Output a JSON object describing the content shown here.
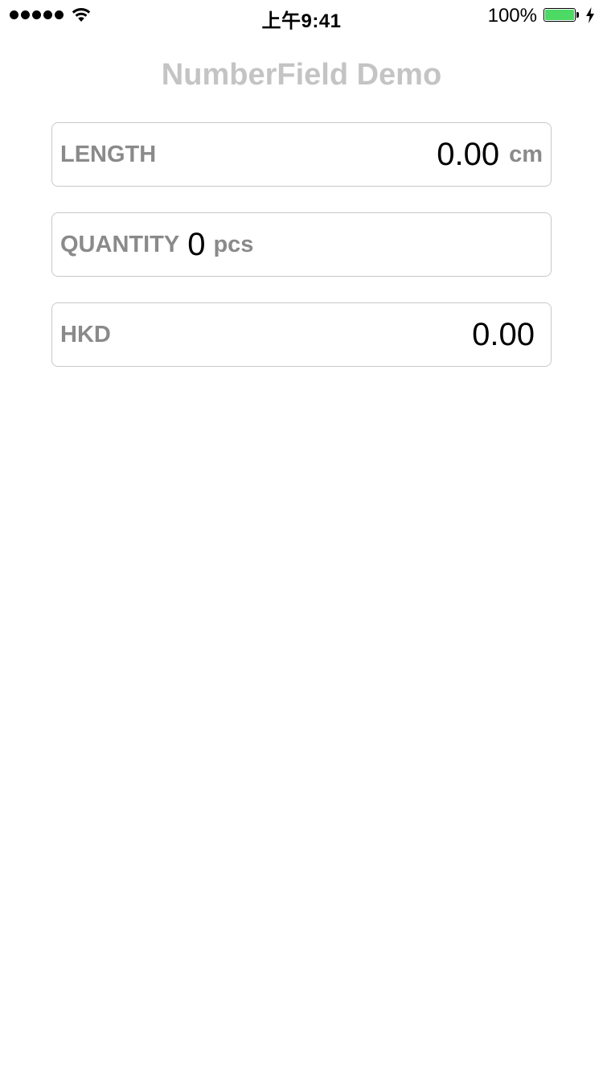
{
  "status_bar": {
    "time": "上午9:41",
    "battery_percent": "100%",
    "signal_bars": 5,
    "battery_level": 1.0,
    "charging": true,
    "battery_color": "#4cd964"
  },
  "header": {
    "title": "NumberField Demo"
  },
  "fields": {
    "length": {
      "label": "LENGTH",
      "value": "0.00",
      "unit": "cm"
    },
    "quantity": {
      "label": "QUANTITY",
      "value": "0",
      "unit": "pcs"
    },
    "hkd": {
      "label": "HKD",
      "value": "0.00"
    }
  },
  "colors": {
    "title": "#c4c4c4",
    "label": "#8a8a8a",
    "field_border": "#c8c8cc"
  }
}
